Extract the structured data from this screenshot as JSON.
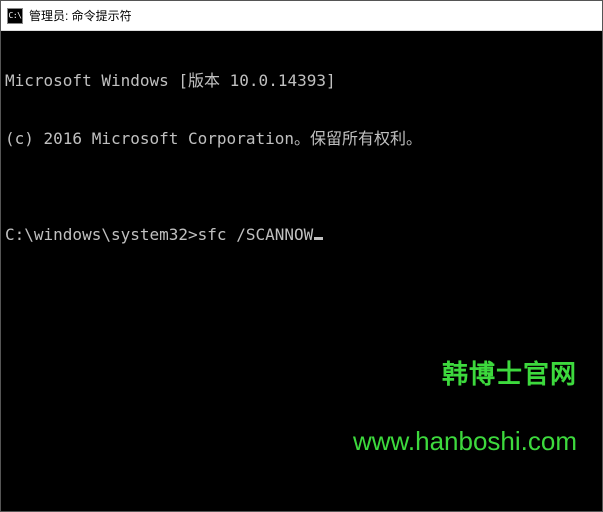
{
  "window": {
    "icon_text": "C:\\",
    "title": "管理员: 命令提示符"
  },
  "terminal": {
    "line1": "Microsoft Windows [版本 10.0.14393]",
    "line2": "(c) 2016 Microsoft Corporation。保留所有权利。",
    "blank": "",
    "prompt": "C:\\windows\\system32>",
    "command": "sfc /SCANNOW"
  },
  "watermark": {
    "text_cn": "韩博士官网",
    "url": "www.hanboshi.com"
  }
}
